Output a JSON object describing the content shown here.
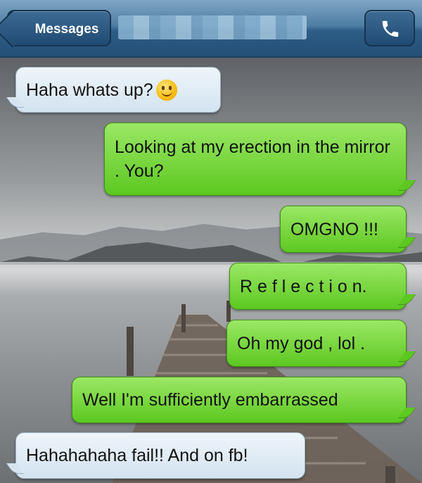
{
  "header": {
    "back_label": "Messages",
    "contact_name": "",
    "call_icon": "phone-icon"
  },
  "messages": [
    {
      "side": "incoming",
      "text": "Haha whats up?",
      "emoji": "smiley-emoji-icon"
    },
    {
      "side": "outgoing",
      "text": "Looking at my erection in the mirror . You?"
    },
    {
      "side": "outgoing",
      "text": "OMGNO !!!"
    },
    {
      "side": "outgoing",
      "text": "R e f l e c t i o n."
    },
    {
      "side": "outgoing",
      "text": "Oh my god , lol ."
    },
    {
      "side": "outgoing",
      "text": "Well I'm sufficiently embarrassed"
    },
    {
      "side": "incoming",
      "text": "Hahahahaha fail!! And on fb!"
    }
  ],
  "colors": {
    "outgoing_bubble": "#5cc820",
    "incoming_bubble": "#dbe8f3",
    "header_bar": "#2c5d86"
  }
}
